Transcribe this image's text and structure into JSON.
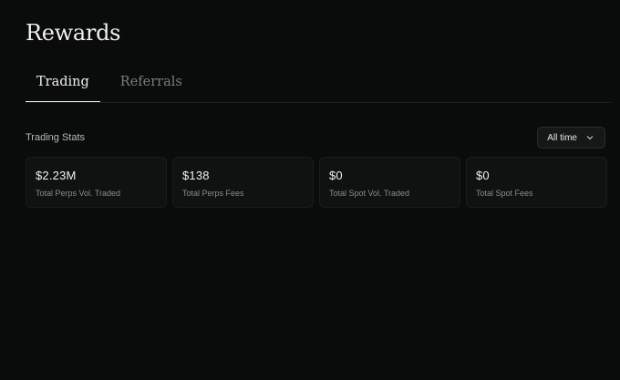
{
  "page": {
    "title": "Rewards"
  },
  "tabs": [
    {
      "label": "Trading",
      "active": true
    },
    {
      "label": "Referrals",
      "active": false
    }
  ],
  "stats_section": {
    "title": "Trading Stats",
    "timeframe": {
      "selected": "All time",
      "icon": "chevron-down-icon"
    }
  },
  "stat_cards": [
    {
      "value": "$2.23M",
      "label": "Total Perps Vol. Traded"
    },
    {
      "value": "$138",
      "label": "Total Perps Fees"
    },
    {
      "value": "$0",
      "label": "Total Spot Vol. Traded"
    },
    {
      "value": "$0",
      "label": "Total Spot Fees"
    }
  ],
  "colors": {
    "background": "#0a0b0b",
    "card_background": "#101211",
    "text_primary": "#f1f1ee",
    "text_muted": "#7b7d7c"
  }
}
